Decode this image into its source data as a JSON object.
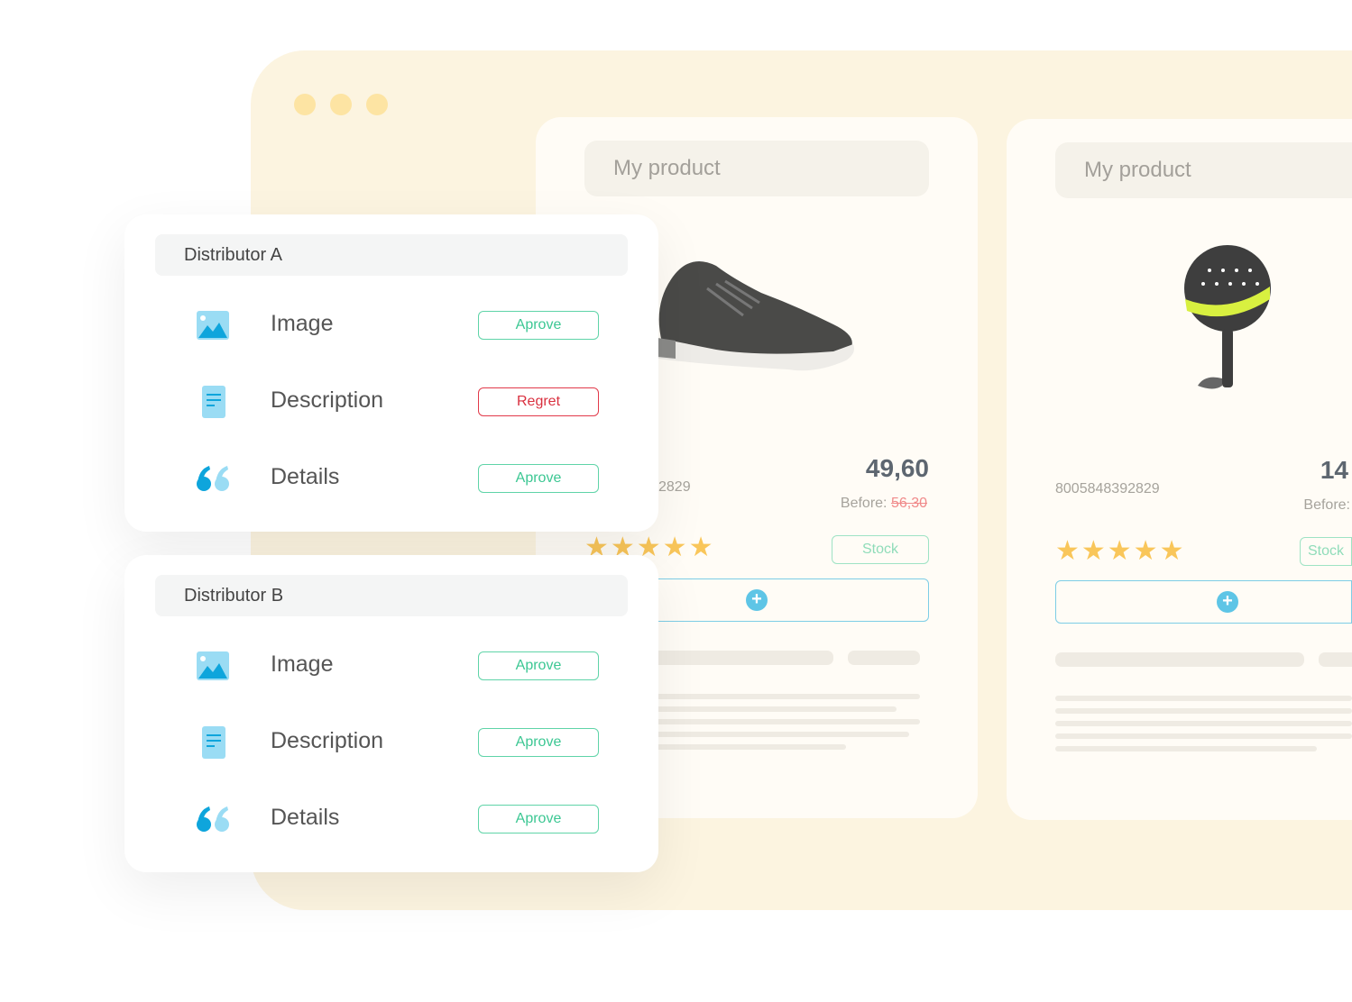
{
  "window": {
    "dots": [
      "dot-1",
      "dot-2",
      "dot-3"
    ]
  },
  "products": [
    {
      "title": "My product",
      "sku": "2829",
      "price": "49,60",
      "before_label": "Before:",
      "before_price": "56,30",
      "stock_label": "Stock",
      "rating": 5
    },
    {
      "title": "My product",
      "sku": "8005848392829",
      "price": "14",
      "before_label": "Before:",
      "stock_label": "Stock",
      "rating": 5
    }
  ],
  "distributors": [
    {
      "name": "Distributor A",
      "rows": [
        {
          "label": "Image",
          "icon": "image-icon",
          "action": "Aprove",
          "status": "approve"
        },
        {
          "label": "Description",
          "icon": "document-icon",
          "action": "Regret",
          "status": "regret"
        },
        {
          "label": "Details",
          "icon": "quote-icon",
          "action": "Aprove",
          "status": "approve"
        }
      ]
    },
    {
      "name": "Distributor B",
      "rows": [
        {
          "label": "Image",
          "icon": "image-icon",
          "action": "Aprove",
          "status": "approve"
        },
        {
          "label": "Description",
          "icon": "document-icon",
          "action": "Aprove",
          "status": "approve"
        },
        {
          "label": "Details",
          "icon": "quote-icon",
          "action": "Aprove",
          "status": "approve"
        }
      ]
    }
  ],
  "colors": {
    "approve": "#3cc793",
    "regret": "#d9303f",
    "star": "#f9c65a",
    "accent": "#5ec5e6"
  }
}
